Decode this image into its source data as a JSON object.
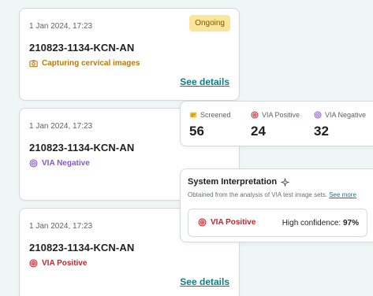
{
  "cards": [
    {
      "timestamp": "1 Jan 2024, 17:23",
      "code": "210823-1134-KCN-AN",
      "badge": "Ongoing",
      "status": "Capturing cervical images",
      "details_link": "See details"
    },
    {
      "timestamp": "1 Jan 2024, 17:23",
      "code": "210823-1134-KCN-AN",
      "status": "VIA Negative"
    },
    {
      "timestamp": "1 Jan 2024, 17:23",
      "code": "210823-1134-KCN-AN",
      "status": "VIA Positive",
      "details_link": "See details"
    }
  ],
  "stats": [
    {
      "label": "Screened",
      "value": "56",
      "icon": "screened-icon",
      "color": "#d8a011"
    },
    {
      "label": "VIA Positive",
      "value": "24",
      "icon": "via-positive-icon",
      "color": "#c0262d"
    },
    {
      "label": "VIA Negative",
      "value": "32",
      "icon": "via-negative-icon",
      "color": "#8a54d8"
    }
  ],
  "interpretation": {
    "title": "System Interpretation",
    "subtitle": "Obtained from the analysis of VIA test image sets.",
    "see_more": "See more",
    "result": "VIA Positive",
    "confidence_label": "High confidence:",
    "confidence_value": "97%"
  },
  "colors": {
    "accent": "#0e7c86",
    "ongoing_badge": "#fbe59a",
    "positive": "#c0262d",
    "negative": "#8a54d8",
    "capturing": "#b97a09"
  }
}
